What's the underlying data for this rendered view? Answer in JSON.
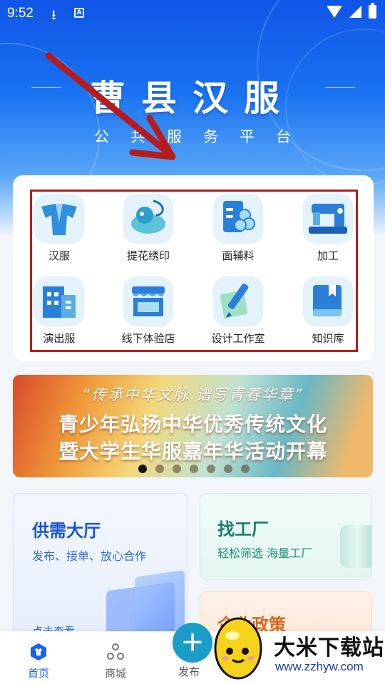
{
  "status_bar": {
    "time": "9:52"
  },
  "header": {
    "title": "曹县汉服",
    "subtitle": "公共服务平台"
  },
  "categories": [
    {
      "label": "汉服",
      "icon": "hanfu-icon"
    },
    {
      "label": "提花绣印",
      "icon": "embroidery-icon"
    },
    {
      "label": "面辅料",
      "icon": "fabric-icon"
    },
    {
      "label": "加工",
      "icon": "sewing-machine-icon"
    },
    {
      "label": "演出服",
      "icon": "building-icon"
    },
    {
      "label": "线下体验店",
      "icon": "store-icon"
    },
    {
      "label": "设计工作室",
      "icon": "design-icon"
    },
    {
      "label": "知识库",
      "icon": "book-icon"
    }
  ],
  "banner": {
    "line1": "“传承中华文脉 谱写青春华章”",
    "line2": "青少年弘扬中华优秀传统文化",
    "line3": "暨大学生华服嘉年华活动开幕",
    "page_count": 7,
    "active_index": 0
  },
  "tiles": {
    "supply": {
      "title": "供需大厅",
      "desc": "发布、接单、放心合作",
      "link": "点击查看"
    },
    "factory": {
      "title": "找工厂",
      "desc": "轻松筛选 海量工厂"
    },
    "biz": {
      "title": "企业政策"
    }
  },
  "tabbar": {
    "home": "首页",
    "mall": "商城",
    "publish": "发布"
  },
  "watermark": {
    "title": "大米下载站",
    "url": "www.zzhyw.com"
  },
  "colors": {
    "accent": "#1565e6",
    "annotation_red": "#b71c1c"
  }
}
